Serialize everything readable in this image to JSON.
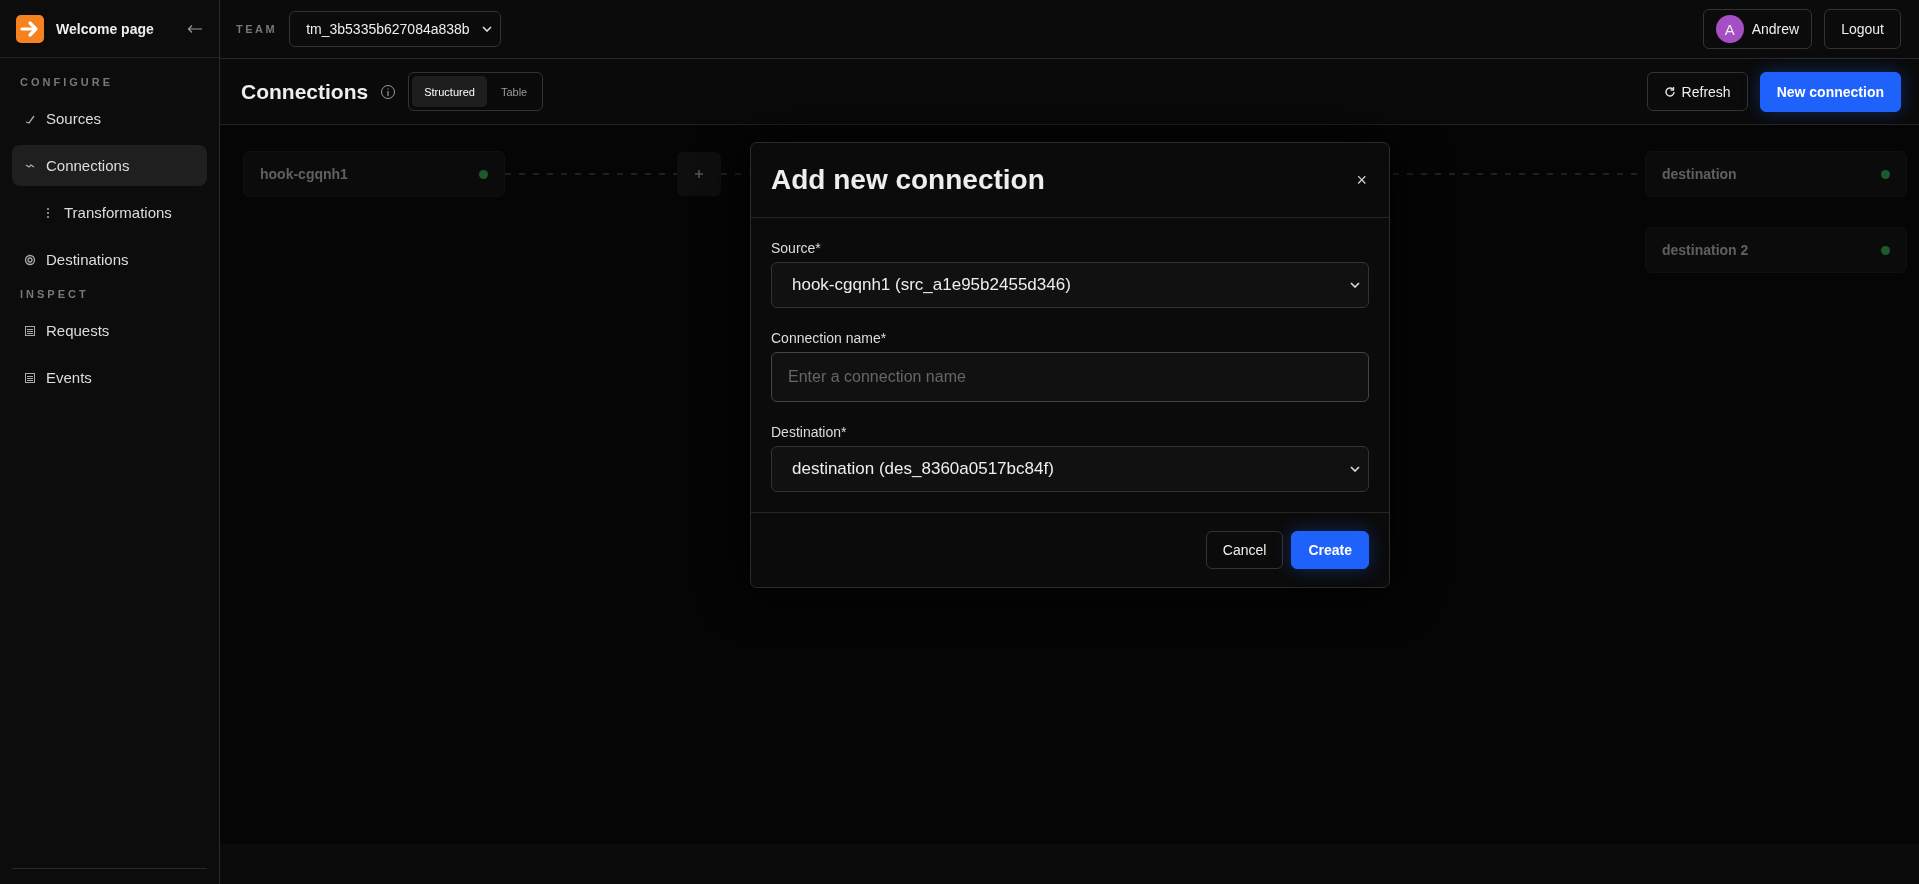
{
  "sidebar": {
    "title": "Welcome page",
    "sections": [
      {
        "heading": "CONFIGURE",
        "items": [
          {
            "label": "Sources",
            "selected": false
          },
          {
            "label": "Connections",
            "selected": true,
            "children": [
              {
                "label": "Transformations",
                "selected": false
              }
            ]
          },
          {
            "label": "Destinations",
            "selected": false
          }
        ]
      },
      {
        "heading": "INSPECT",
        "items": [
          {
            "label": "Requests",
            "selected": false
          },
          {
            "label": "Events",
            "selected": false
          }
        ]
      }
    ]
  },
  "topbar": {
    "team_label": "TEAM",
    "team": "tm_3b5335b627084a838b",
    "user": {
      "initial": "A",
      "name": "Andrew",
      "color": "#a64fc4"
    },
    "logout": "Logout"
  },
  "header": {
    "title": "Connections",
    "view_tabs": [
      {
        "label": "Structured",
        "selected": true
      },
      {
        "label": "Table",
        "selected": false
      }
    ],
    "refresh": "Refresh",
    "new_button": "New connection"
  },
  "canvas": {
    "sources": [
      {
        "name": "hook-cgqnh1"
      }
    ],
    "destinations": [
      {
        "name": "destination"
      },
      {
        "name": "destination 2"
      }
    ]
  },
  "dialog": {
    "title": "Add new connection",
    "close": "×",
    "fields": [
      {
        "kind": "select",
        "label": "Source*",
        "value": "hook-cgqnh1 (src_a1e95b2455d346)"
      },
      {
        "kind": "text",
        "label": "Connection name*",
        "placeholder": "Enter a connection name"
      },
      {
        "kind": "select",
        "label": "Destination*",
        "value": "destination (des_8360a0517bc84f)"
      }
    ],
    "cancel": "Cancel",
    "create": "Create"
  }
}
